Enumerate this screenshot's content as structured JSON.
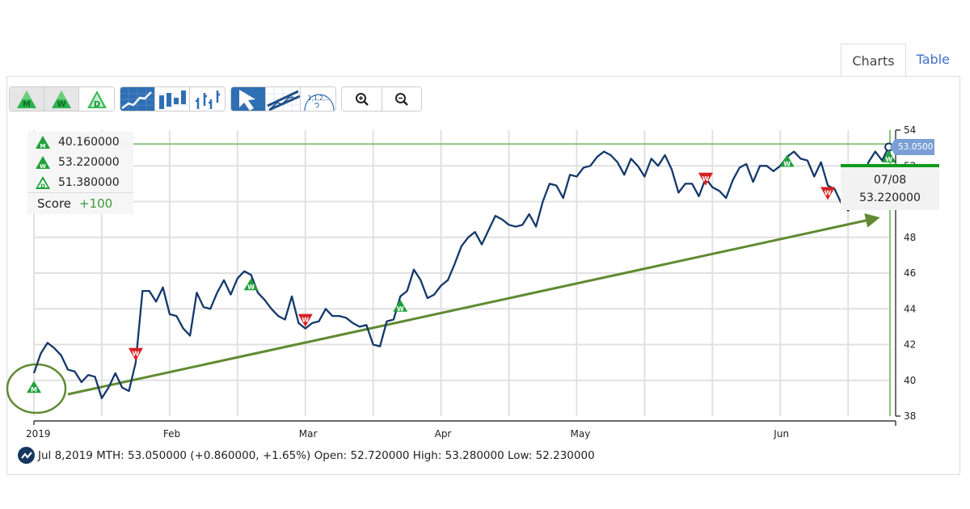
{
  "tabs": [
    {
      "label": "Charts",
      "active": true
    },
    {
      "label": "Table",
      "active": false
    }
  ],
  "toolbar": {
    "signal_buttons": [
      {
        "name": "monthly-signal",
        "letter": "M",
        "icon": "triangle-m-icon"
      },
      {
        "name": "weekly-signal",
        "letter": "W",
        "icon": "triangle-w-icon"
      },
      {
        "name": "daily-signal",
        "letter": "D",
        "icon": "triangle-d-icon"
      }
    ],
    "chart_type_buttons": [
      {
        "name": "line-chart",
        "icon": "line-chart-icon",
        "selected": true
      },
      {
        "name": "candlestick-chart",
        "icon": "candlestick-icon",
        "selected": false
      },
      {
        "name": "ohlc-chart",
        "icon": "ohlc-bars-icon",
        "selected": false
      }
    ],
    "tool_buttons": [
      {
        "name": "pointer",
        "icon": "cursor-arrow-icon",
        "selected": true
      },
      {
        "name": "trendline",
        "icon": "trendline-icon",
        "selected": false
      },
      {
        "name": "fibonacci",
        "icon": "fibonacci-icon",
        "label": "1,1,2,...",
        "selected": false
      }
    ],
    "zoom_buttons": [
      {
        "name": "zoom-in",
        "icon": "zoom-in-icon"
      },
      {
        "name": "zoom-out",
        "icon": "zoom-out-icon"
      }
    ]
  },
  "legend": {
    "items": [
      {
        "letter": "M",
        "value": "40.160000"
      },
      {
        "letter": "W",
        "value": "53.220000"
      },
      {
        "letter": "D",
        "value": "51.380000"
      }
    ],
    "score_label": "Score",
    "score_value": "+100"
  },
  "tooltip": {
    "date": "07/08",
    "value": "53.220000"
  },
  "price_flag": "53.0500",
  "status": {
    "date": "Jul 8,2019",
    "symbol": "MTH",
    "text": "Jul 8,2019 MTH: 53.050000 (+0.860000, +1.65%) Open: 52.720000 High: 53.280000 Low: 52.230000",
    "close": "53.050000",
    "change": "+0.860000",
    "change_pct": "+1.65%",
    "open": "52.720000",
    "high": "53.280000",
    "low": "52.230000"
  },
  "colors": {
    "line": "#14386b",
    "grid": "#e0e0e0",
    "signal_green": "#1fa23a",
    "signal_red": "#d62020",
    "trend": "#5f8a32",
    "level_line": "#8cc47a",
    "tooltip_bar": "#119a1d",
    "flag": "#7a9fd5"
  },
  "chart_data": {
    "type": "line",
    "title": "",
    "symbol": "MTH",
    "xlabel": "",
    "ylabel": "",
    "ylim": [
      38,
      54
    ],
    "yticks": [
      38,
      40,
      42,
      44,
      46,
      48,
      50,
      52,
      54
    ],
    "xlim": [
      0,
      127
    ],
    "xticks": [
      {
        "label": "2019",
        "x": 0
      },
      {
        "label": "Feb",
        "x": 20
      },
      {
        "label": "Mar",
        "x": 40
      },
      {
        "label": "Apr",
        "x": 60
      },
      {
        "label": "May",
        "x": 80
      },
      {
        "label": "Jun",
        "x": 110
      }
    ],
    "grid": true,
    "series": [
      {
        "name": "MTH",
        "x": [
          0,
          1,
          2,
          3,
          4,
          5,
          6,
          7,
          8,
          9,
          10,
          11,
          12,
          13,
          14,
          15,
          16,
          17,
          18,
          19,
          20,
          21,
          22,
          23,
          24,
          25,
          26,
          27,
          28,
          29,
          30,
          31,
          32,
          33,
          34,
          35,
          36,
          37,
          38,
          39,
          40,
          41,
          42,
          43,
          44,
          45,
          46,
          47,
          48,
          49,
          50,
          51,
          52,
          53,
          54,
          55,
          56,
          57,
          58,
          59,
          60,
          61,
          62,
          63,
          64,
          65,
          66,
          67,
          68,
          69,
          70,
          71,
          72,
          73,
          74,
          75,
          76,
          77,
          78,
          79,
          80,
          81,
          82,
          83,
          84,
          85,
          86,
          87,
          88,
          89,
          90,
          91,
          92,
          93,
          94,
          95,
          96,
          97,
          98,
          99,
          100,
          101,
          102,
          103,
          104,
          105,
          106,
          107,
          108,
          109,
          110,
          111,
          112,
          113,
          114,
          115,
          116,
          117,
          118,
          119,
          120,
          121,
          122,
          123,
          124,
          125,
          126
        ],
        "values": [
          40.4,
          41.5,
          42.1,
          41.8,
          41.4,
          40.6,
          40.5,
          39.9,
          40.3,
          40.2,
          39.0,
          39.6,
          40.4,
          39.6,
          39.4,
          41.0,
          45.0,
          45.0,
          44.4,
          45.2,
          43.7,
          43.6,
          42.9,
          42.5,
          44.9,
          44.1,
          44.0,
          44.9,
          45.6,
          44.8,
          45.7,
          46.1,
          45.9,
          44.9,
          44.5,
          44.0,
          43.6,
          43.4,
          44.7,
          43.2,
          42.9,
          43.2,
          43.3,
          44.0,
          43.6,
          43.6,
          43.5,
          43.2,
          43.0,
          43.1,
          42.0,
          41.9,
          43.3,
          43.4,
          44.7,
          45.0,
          46.2,
          45.6,
          44.6,
          44.8,
          45.3,
          45.6,
          46.5,
          47.5,
          48.0,
          48.3,
          47.6,
          48.4,
          49.2,
          49.0,
          48.7,
          48.6,
          48.7,
          49.3,
          48.6,
          50.0,
          51.0,
          50.9,
          50.2,
          51.5,
          51.4,
          51.9,
          52.0,
          52.5,
          52.8,
          52.6,
          52.2,
          51.5,
          52.4,
          52.0,
          51.4,
          52.4,
          52.0,
          52.6,
          51.8,
          50.5,
          51.0,
          51.0,
          50.3,
          51.3,
          50.8,
          50.6,
          50.2,
          51.2,
          51.9,
          52.1,
          51.1,
          52.0,
          52.0,
          51.7,
          52.0,
          52.5,
          52.8,
          52.4,
          52.3,
          51.4,
          52.2,
          50.9,
          50.7,
          49.9,
          49.5,
          49.9,
          null,
          52.2,
          52.8,
          52.3,
          53.05
        ]
      }
    ],
    "signals": [
      {
        "type": "M",
        "direction": "up",
        "x": 0,
        "price": 40.16
      },
      {
        "type": "W",
        "direction": "down",
        "x": 15,
        "price": 41.0
      },
      {
        "type": "W",
        "direction": "up",
        "x": 32,
        "price": 45.9
      },
      {
        "type": "W",
        "direction": "down",
        "x": 40,
        "price": 42.9
      },
      {
        "type": "W",
        "direction": "up",
        "x": 54,
        "price": 44.7
      },
      {
        "type": "W",
        "direction": "down",
        "x": 99,
        "price": 50.8
      },
      {
        "type": "W",
        "direction": "up",
        "x": 111,
        "price": 52.8
      },
      {
        "type": "W",
        "direction": "down",
        "x": 117,
        "price": 50.0
      },
      {
        "type": "W",
        "direction": "up",
        "x": 126,
        "price": 53.05
      }
    ],
    "horizontal_level": 53.22,
    "trendline": {
      "from": {
        "x": 5,
        "price": 39.5
      },
      "to": {
        "x": 124,
        "price": 49.0
      }
    },
    "last_value": 53.05,
    "crosshair_x": 126
  }
}
